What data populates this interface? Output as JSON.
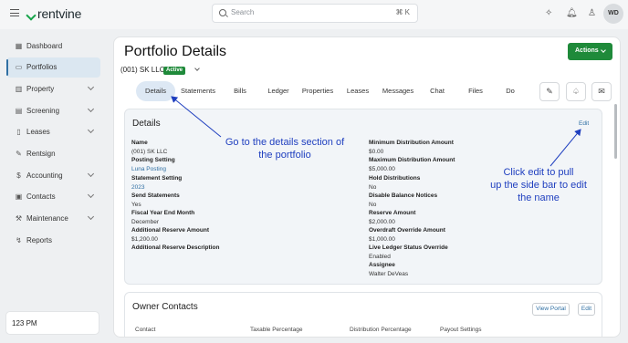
{
  "app": {
    "brand": "rentvine"
  },
  "search": {
    "placeholder": "Search",
    "shortcut": "⌘ K"
  },
  "user": {
    "initials": "WD"
  },
  "sidebar": {
    "items": [
      {
        "label": "Dashboard",
        "icon": "dashboard-icon"
      },
      {
        "label": "Portfolios",
        "icon": "folder-icon",
        "active": true
      },
      {
        "label": "Property",
        "icon": "building-icon",
        "expandable": true
      },
      {
        "label": "Screening",
        "icon": "screening-icon",
        "expandable": true
      },
      {
        "label": "Leases",
        "icon": "document-icon",
        "expandable": true
      },
      {
        "label": "Rentsign",
        "icon": "signature-icon"
      },
      {
        "label": "Accounting",
        "icon": "dollar-icon",
        "expandable": true
      },
      {
        "label": "Contacts",
        "icon": "contacts-icon",
        "expandable": true
      },
      {
        "label": "Maintenance",
        "icon": "wrench-icon",
        "expandable": true
      },
      {
        "label": "Reports",
        "icon": "reports-icon"
      }
    ],
    "time": "123 PM"
  },
  "page": {
    "title": "Portfolio Details",
    "actions_label": "Actions",
    "portfolio_name": "(001) SK LLC",
    "status_badge": "Active"
  },
  "tabs": [
    "Details",
    "Statements",
    "Bills",
    "Ledger",
    "Properties",
    "Leases",
    "Messages",
    "Chat",
    "Files",
    "Do"
  ],
  "details": {
    "title": "Details",
    "edit_label": "Edit",
    "left": [
      {
        "label": "Name",
        "value": "(001) SK LLC"
      },
      {
        "label": "Posting Setting",
        "value": "Luna Posting"
      },
      {
        "label": "Statement Setting",
        "value": "2023"
      },
      {
        "label": "Send Statements",
        "value": "Yes"
      },
      {
        "label": "Fiscal Year End Month",
        "value": "December"
      },
      {
        "label": "Additional Reserve Amount",
        "value": "$1,200.00"
      },
      {
        "label": "Additional Reserve Description",
        "value": ""
      }
    ],
    "right": [
      {
        "label": "Minimum Distribution Amount",
        "value": "$0.00"
      },
      {
        "label": "Maximum Distribution Amount",
        "value": "$5,000.00"
      },
      {
        "label": "Hold Distributions",
        "value": "No"
      },
      {
        "label": "Disable Balance Notices",
        "value": "No"
      },
      {
        "label": "Reserve Amount",
        "value": "$2,000.00"
      },
      {
        "label": "Overdraft Override Amount",
        "value": "$1,000.00"
      },
      {
        "label": "Live Ledger Status Override",
        "value": "Enabled"
      },
      {
        "label": "Assignee",
        "value": "Walter DeVeas"
      }
    ]
  },
  "owner_contacts": {
    "title": "Owner Contacts",
    "view_portal_label": "View Portal",
    "edit_label": "Edit",
    "columns": [
      "Contact",
      "Taxable Percentage",
      "Distribution Percentage",
      "Payout Settings"
    ]
  },
  "annotations": {
    "details_note": [
      "Go to the details section of",
      "the portfolio"
    ],
    "edit_note": [
      "Click edit to pull",
      "up the side bar to edit",
      "the name"
    ]
  },
  "colors": {
    "accent": "#1f8a3a",
    "link": "#2f6fa3",
    "annotation": "#1f3fbf"
  }
}
